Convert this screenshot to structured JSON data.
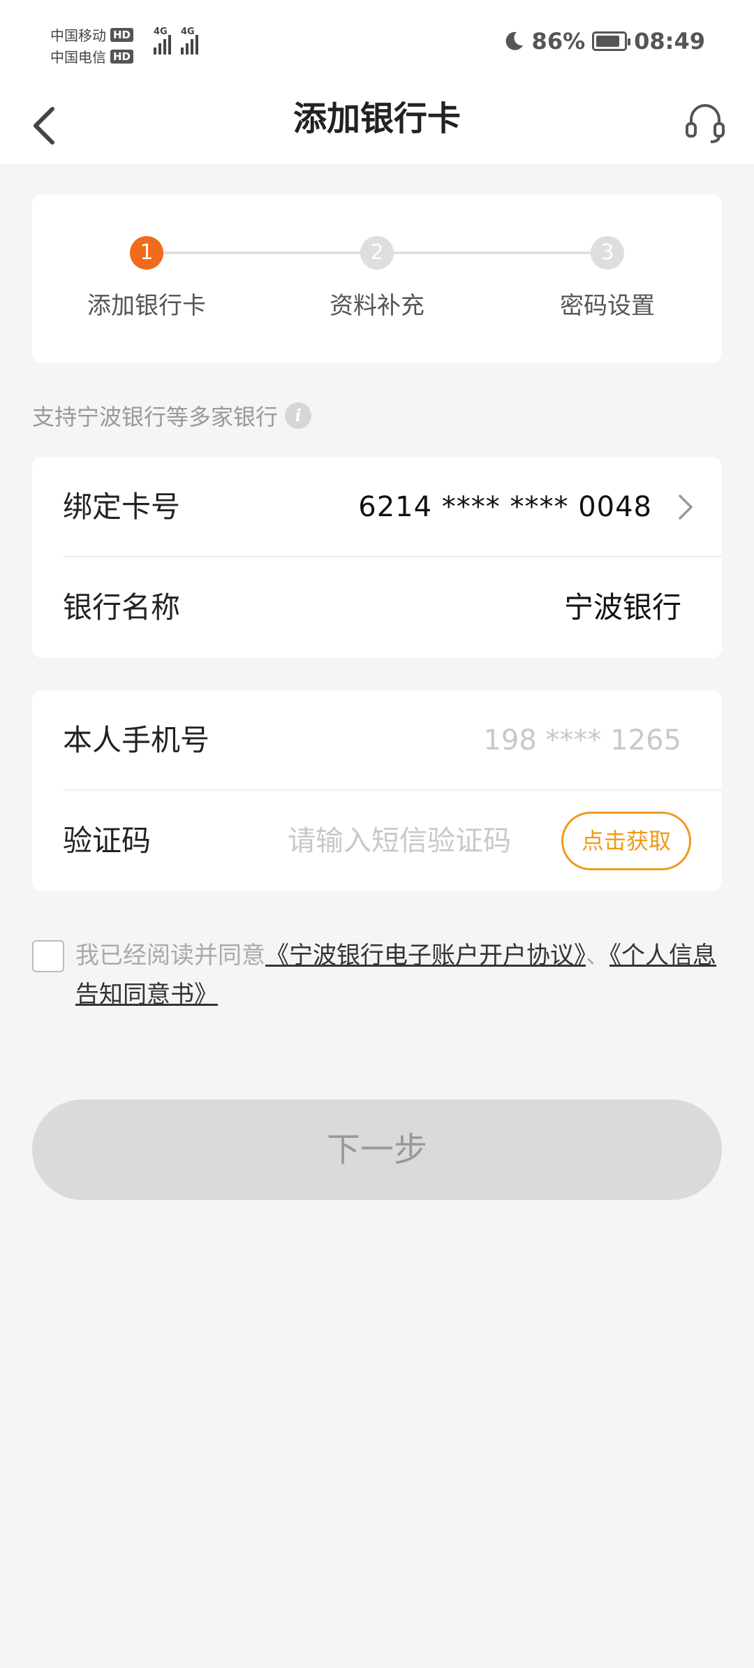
{
  "status_bar": {
    "carrier_1": "中国移动",
    "carrier_2": "中国电信",
    "hd_label": "HD",
    "network_label": "4G",
    "battery_percent": "86%",
    "battery_level": 0.86,
    "time": "08:49",
    "icons": [
      "moon-icon",
      "battery-icon",
      "signal-icon"
    ]
  },
  "nav": {
    "title": "添加银行卡",
    "back_icon": "chevron-left-icon",
    "service_icon": "headset-icon"
  },
  "stepper": {
    "steps": [
      {
        "number": "1",
        "label": "添加银行卡",
        "active": true
      },
      {
        "number": "2",
        "label": "资料补充",
        "active": false
      },
      {
        "number": "3",
        "label": "密码设置",
        "active": false
      }
    ],
    "active_color": "#f26a1b"
  },
  "support": {
    "text": "支持宁波银行等多家银行",
    "info_glyph": "i"
  },
  "bank_card": {
    "card_label": "绑定卡号",
    "card_number": "6214 **** **** 0048",
    "bank_label": "银行名称",
    "bank_name": "宁波银行"
  },
  "phone_card": {
    "phone_label": "本人手机号",
    "phone_value": "198 **** 1265",
    "code_label": "验证码",
    "code_placeholder": "请输入短信验证码",
    "get_code_label": "点击获取",
    "accent_color": "#ef9a1a"
  },
  "agreement": {
    "prefix": "我已经阅读并同意",
    "link_1": "《宁波银行电子账户开户协议》",
    "separator": "、",
    "link_2": "《个人信息告知同意书》",
    "checked": false
  },
  "next_button": {
    "label": "下一步",
    "enabled": false
  }
}
